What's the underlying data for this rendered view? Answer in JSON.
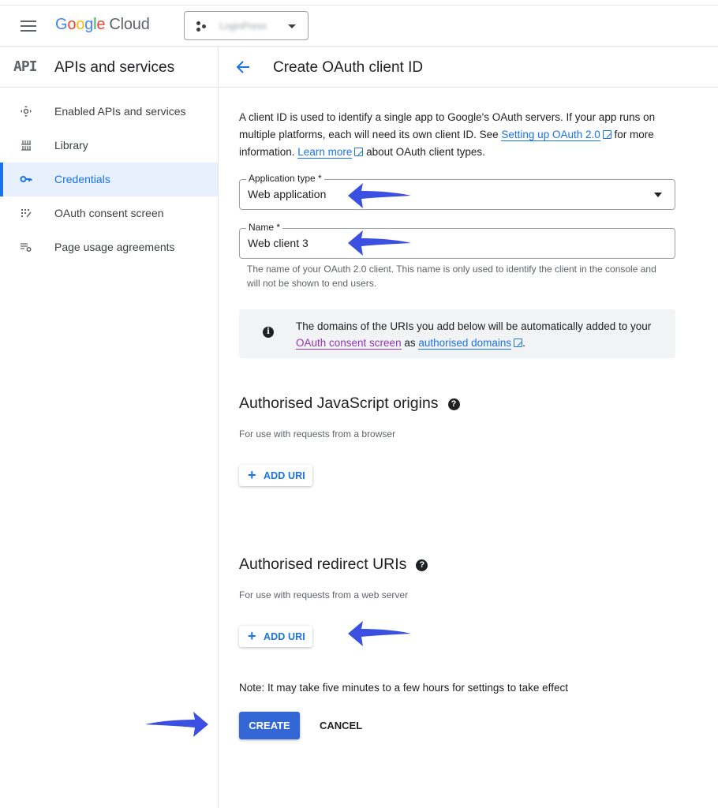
{
  "topbar": {
    "menu_icon": "hamburger-menu-icon",
    "logo": {
      "google": [
        "G",
        "o",
        "o",
        "g",
        "l",
        "e"
      ],
      "cloud": "Cloud"
    },
    "project": {
      "name": "LoginPress",
      "icon": "project-dots-icon",
      "caret": "caret-down-icon"
    }
  },
  "sidebar": {
    "badge": "API",
    "title": "APIs and services",
    "items": [
      {
        "label": "Enabled APIs and services",
        "icon": "enabled-apis-icon",
        "active": false
      },
      {
        "label": "Library",
        "icon": "library-icon",
        "active": false
      },
      {
        "label": "Credentials",
        "icon": "key-icon",
        "active": true
      },
      {
        "label": "OAuth consent screen",
        "icon": "consent-screen-icon",
        "active": false
      },
      {
        "label": "Page usage agreements",
        "icon": "settings-list-icon",
        "active": false
      }
    ]
  },
  "main": {
    "back_icon": "arrow-back-icon",
    "title": "Create OAuth client ID",
    "intro": {
      "part1": "A client ID is used to identify a single app to Google's OAuth servers. If your app runs on multiple platforms, each will need its own client ID. See ",
      "link1": "Setting up OAuth 2.0",
      "part2": " for more information. ",
      "link2": "Learn more",
      "part3": " about OAuth client types."
    },
    "application_type": {
      "label": "Application type *",
      "value": "Web application"
    },
    "name_field": {
      "label": "Name *",
      "value": "Web client 3",
      "hint": "The name of your OAuth 2.0 client. This name is only used to identify the client in the console and will not be shown to end users."
    },
    "info": {
      "part1": "The domains of the URIs you add below will be automatically added to your ",
      "link1": "OAuth consent screen",
      "part2": " as ",
      "link2": "authorised domains",
      "part3": "."
    },
    "js_origins": {
      "title": "Authorised JavaScript origins",
      "subtitle": "For use with requests from a browser",
      "add_label": "ADD URI"
    },
    "redirect_uris": {
      "title": "Authorised redirect URIs",
      "subtitle": "For use with requests from a web server",
      "add_label": "ADD URI"
    },
    "note": "Note: It may take five minutes to a few hours for settings to take effect",
    "create_label": "CREATE",
    "cancel_label": "CANCEL"
  },
  "annotations": {
    "arrow_color": "#3b4fe0"
  },
  "colors": {
    "accent": "#1a73e8",
    "primary_button": "#3367d6",
    "visited_link": "#9334b5"
  }
}
